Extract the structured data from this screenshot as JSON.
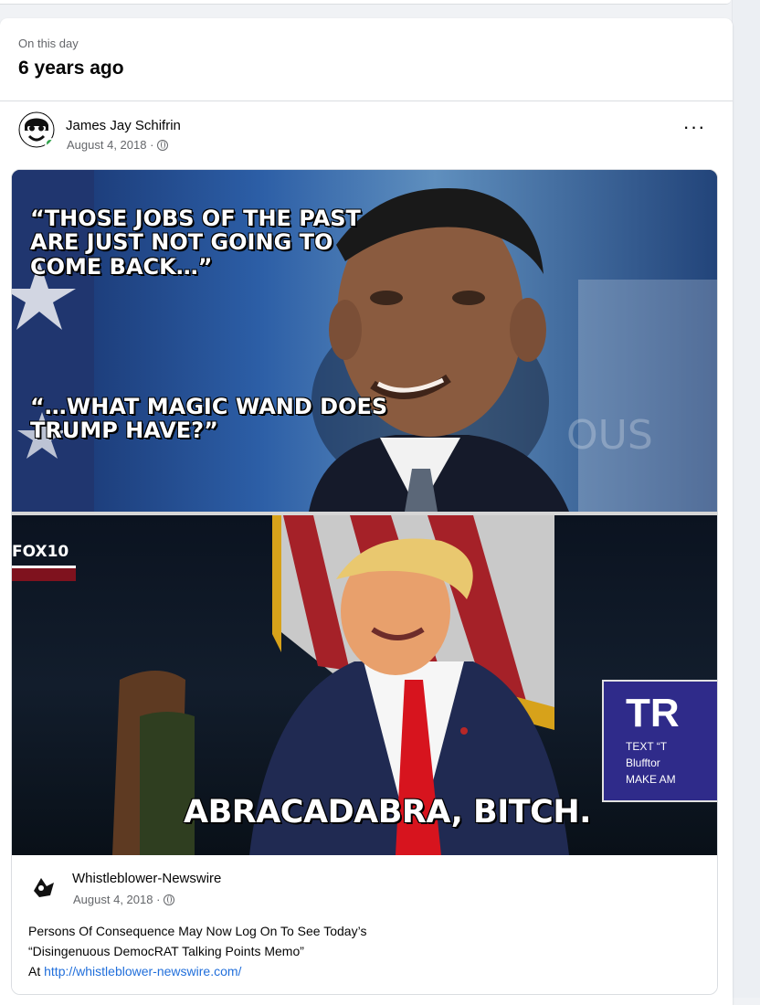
{
  "memory": {
    "kicker": "On this day",
    "years": "6 years ago"
  },
  "post": {
    "author": "James Jay Schifrin",
    "date": "August 4, 2018 ·",
    "more_label": "···"
  },
  "meme": {
    "caption_top_1": "“THOSE JOBS OF THE PAST",
    "caption_top_2": "ARE JUST NOT GOING TO",
    "caption_top_3": "COME BACK…”",
    "caption_mid_1": "“…WHAT MAGIC WAND DOES",
    "caption_mid_2": "TRUMP HAVE?”",
    "caption_bottom": "ABRACADABRA, BITCH.",
    "logo": "FOX10",
    "sign_big": "TR",
    "sign_small_1": "TEXT “T",
    "sign_small_2": "Blufftor",
    "sign_small_3": "MAKE AM"
  },
  "shared": {
    "page_name": "Whistleblower-Newswire",
    "date": "August 4, 2018 ·",
    "text_line_1": "Persons Of Consequence May Now Log On To See Today’s",
    "text_line_2": "“Disingenuous DemocRAT Talking Points Memo”",
    "text_at": "At ",
    "link_text": "http://whistleblower-newswire.com/"
  }
}
